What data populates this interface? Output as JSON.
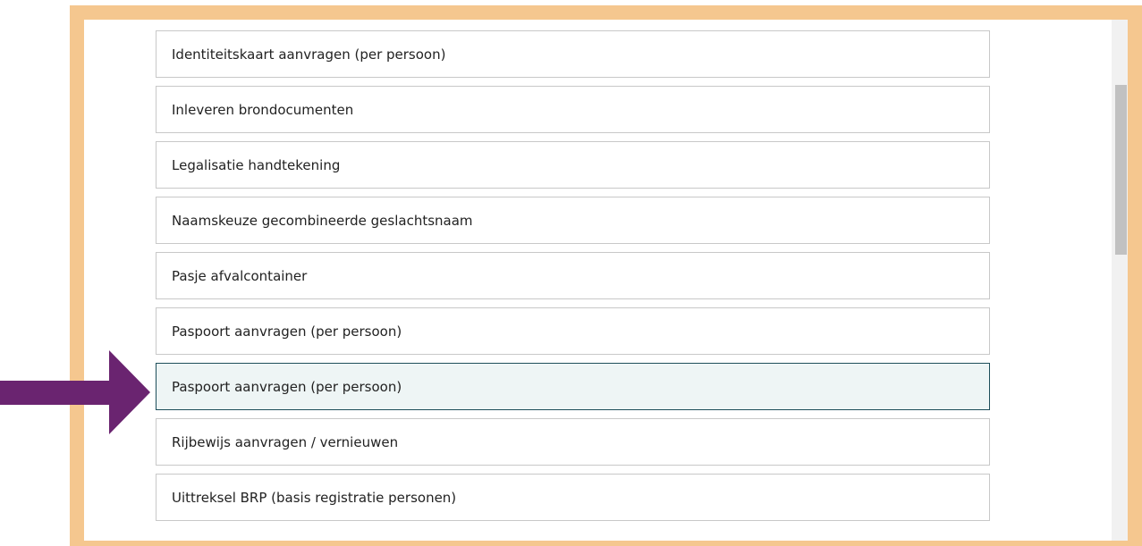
{
  "services": [
    {
      "label": "Identiteitskaart aanvragen (per persoon)",
      "selected": false
    },
    {
      "label": "Inleveren brondocumenten",
      "selected": false
    },
    {
      "label": "Legalisatie handtekening",
      "selected": false
    },
    {
      "label": "Naamskeuze gecombineerde geslachtsnaam",
      "selected": false
    },
    {
      "label": "Pasje afvalcontainer",
      "selected": false
    },
    {
      "label": "Paspoort aanvragen (per persoon)",
      "selected": false
    },
    {
      "label": "Paspoort aanvragen (per persoon)",
      "selected": true
    },
    {
      "label": "Rijbewijs aanvragen / vernieuwen",
      "selected": false
    },
    {
      "label": "Uittreksel BRP (basis registratie personen)",
      "selected": false
    }
  ],
  "colors": {
    "frame": "#f5c78f",
    "arrow": "#6a2470",
    "selected_border": "#1d4e5a",
    "selected_background": "#eef5f5"
  },
  "icons": {
    "annotation": "right-arrow-icon"
  }
}
